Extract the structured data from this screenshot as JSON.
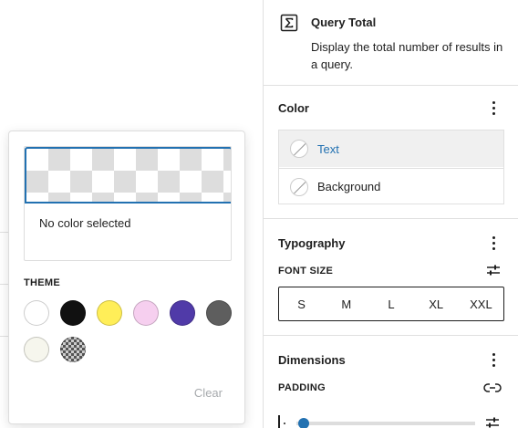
{
  "block": {
    "icon": "sigma-icon",
    "title": "Query Total",
    "description": "Display the total number of results in a query."
  },
  "color_panel": {
    "title": "Color",
    "items": [
      {
        "label": "Text",
        "active": true
      },
      {
        "label": "Background",
        "active": false
      }
    ]
  },
  "typography_panel": {
    "title": "Typography",
    "font_size_label": "FONT SIZE",
    "sizes": [
      "S",
      "M",
      "L",
      "XL",
      "XXL"
    ]
  },
  "dimensions_panel": {
    "title": "Dimensions",
    "padding_label": "PADDING"
  },
  "color_popover": {
    "preview_text": "No color selected",
    "theme_label": "THEME",
    "swatches": [
      {
        "name": "white",
        "color": "#ffffff"
      },
      {
        "name": "black",
        "color": "#111111"
      },
      {
        "name": "yellow",
        "color": "#ffee58"
      },
      {
        "name": "pink",
        "color": "#f6cfef"
      },
      {
        "name": "purple",
        "color": "#503aa8"
      },
      {
        "name": "gray",
        "color": "#5e5e5e"
      },
      {
        "name": "off-white",
        "color": "#f6f6ed"
      },
      {
        "name": "checkered",
        "color": "pattern"
      }
    ],
    "clear_label": "Clear"
  },
  "colors": {
    "accent": "#2271b1",
    "border": "#e0e0e0"
  }
}
